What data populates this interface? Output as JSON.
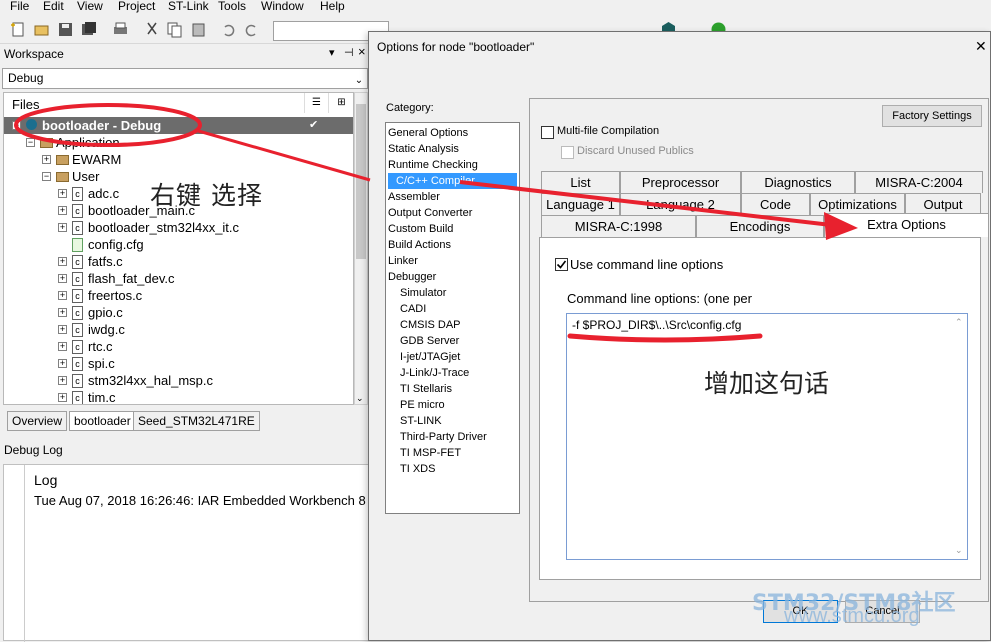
{
  "menubar": {
    "items": [
      "File",
      "Edit",
      "View",
      "Project",
      "ST-Link",
      "Tools",
      "Window",
      "Help"
    ]
  },
  "workspace": {
    "title": "Workspace",
    "config": "Debug",
    "files_header": "Files",
    "tree": [
      {
        "label": "bootloader - Debug",
        "depth": 0,
        "type": "project"
      },
      {
        "label": "Application",
        "depth": 1,
        "type": "folder"
      },
      {
        "label": "EWARM",
        "depth": 2,
        "type": "folder"
      },
      {
        "label": "User",
        "depth": 2,
        "type": "folder"
      },
      {
        "label": "adc.c",
        "depth": 3,
        "type": "c"
      },
      {
        "label": "bootloader_main.c",
        "depth": 3,
        "type": "c"
      },
      {
        "label": "bootloader_stm32l4xx_it.c",
        "depth": 3,
        "type": "c"
      },
      {
        "label": "config.cfg",
        "depth": 3,
        "type": "cfg"
      },
      {
        "label": "fatfs.c",
        "depth": 3,
        "type": "c"
      },
      {
        "label": "flash_fat_dev.c",
        "depth": 3,
        "type": "c"
      },
      {
        "label": "freertos.c",
        "depth": 3,
        "type": "c"
      },
      {
        "label": "gpio.c",
        "depth": 3,
        "type": "c"
      },
      {
        "label": "iwdg.c",
        "depth": 3,
        "type": "c"
      },
      {
        "label": "rtc.c",
        "depth": 3,
        "type": "c"
      },
      {
        "label": "spi.c",
        "depth": 3,
        "type": "c"
      },
      {
        "label": "stm32l4xx_hal_msp.c",
        "depth": 3,
        "type": "c"
      },
      {
        "label": "tim.c",
        "depth": 3,
        "type": "c"
      }
    ],
    "tabs": [
      "Overview",
      "bootloader",
      "Seed_STM32L471RE"
    ]
  },
  "debug_log": {
    "title": "Debug Log",
    "header": "Log",
    "lines": [
      "Tue Aug 07, 2018 16:26:46: IAR Embedded Workbench 8"
    ]
  },
  "dialog": {
    "title": "Options for node \"bootloader\"",
    "category_label": "Category:",
    "categories": [
      {
        "label": "General Options",
        "sub": false
      },
      {
        "label": "Static Analysis",
        "sub": false
      },
      {
        "label": "Runtime Checking",
        "sub": false
      },
      {
        "label": "C/C++ Compiler",
        "sub": false,
        "selected": true
      },
      {
        "label": "Assembler",
        "sub": false
      },
      {
        "label": "Output Converter",
        "sub": false
      },
      {
        "label": "Custom Build",
        "sub": false
      },
      {
        "label": "Build Actions",
        "sub": false
      },
      {
        "label": "Linker",
        "sub": false
      },
      {
        "label": "Debugger",
        "sub": false
      },
      {
        "label": "Simulator",
        "sub": true
      },
      {
        "label": "CADI",
        "sub": true
      },
      {
        "label": "CMSIS DAP",
        "sub": true
      },
      {
        "label": "GDB Server",
        "sub": true
      },
      {
        "label": "I-jet/JTAGjet",
        "sub": true
      },
      {
        "label": "J-Link/J-Trace",
        "sub": true
      },
      {
        "label": "TI Stellaris",
        "sub": true
      },
      {
        "label": "PE micro",
        "sub": true
      },
      {
        "label": "ST-LINK",
        "sub": true
      },
      {
        "label": "Third-Party Driver",
        "sub": true
      },
      {
        "label": "TI MSP-FET",
        "sub": true
      },
      {
        "label": "TI XDS",
        "sub": true
      }
    ],
    "factory_settings": "Factory Settings",
    "multi_file": "Multi-file Compilation",
    "discard_unused": "Discard Unused Publics",
    "tabs_row1": [
      "List",
      "Preprocessor",
      "Diagnostics",
      "MISRA-C:2004"
    ],
    "tabs_row2": [
      "Language 1",
      "Language 2",
      "Code",
      "Optimizations",
      "Output"
    ],
    "tabs_row3": [
      "MISRA-C:1998",
      "Encodings",
      "Extra Options"
    ],
    "use_cmd_line": "Use command line options",
    "cmd_label": "Command line options:  (one per",
    "cmd_value": "-f $PROJ_DIR$\\..\\Src\\config.cfg",
    "ok": "OK",
    "cancel": "Cancel"
  },
  "annotations": {
    "right_click_select": "右键  选择",
    "add_this_line": "增加这句话",
    "watermark": "STM32/STM8社区",
    "watermark_url": "www.stmcu.org"
  },
  "colors": {
    "selection": "#3399ff",
    "annotation_red": "#e8212e"
  }
}
